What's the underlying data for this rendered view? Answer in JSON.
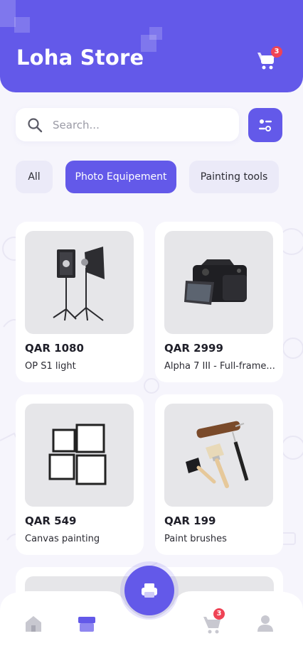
{
  "header": {
    "title": "Loha Store",
    "cart_badge": "3",
    "accent": "#6359e9"
  },
  "search": {
    "placeholder": "Search...",
    "value": ""
  },
  "categories": [
    {
      "label": "All",
      "active": false
    },
    {
      "label": "Photo Equipement",
      "active": true
    },
    {
      "label": "Painting tools",
      "active": false
    }
  ],
  "products": [
    {
      "price": "QAR 1080",
      "name": "OP S1 light",
      "image": "studio-light"
    },
    {
      "price": "QAR 2999",
      "name": "Alpha 7 III - Full-frame...",
      "image": "camera"
    },
    {
      "price": "QAR 549",
      "name": "Canvas painting",
      "image": "frames"
    },
    {
      "price": "QAR 199",
      "name": "Paint brushes",
      "image": "brushes"
    }
  ],
  "bottom_nav": {
    "items": [
      "home-icon",
      "store-icon",
      "cart-icon",
      "profile-icon"
    ],
    "active": "store-icon",
    "cart_badge": "3",
    "fab_icon": "print-icon"
  }
}
